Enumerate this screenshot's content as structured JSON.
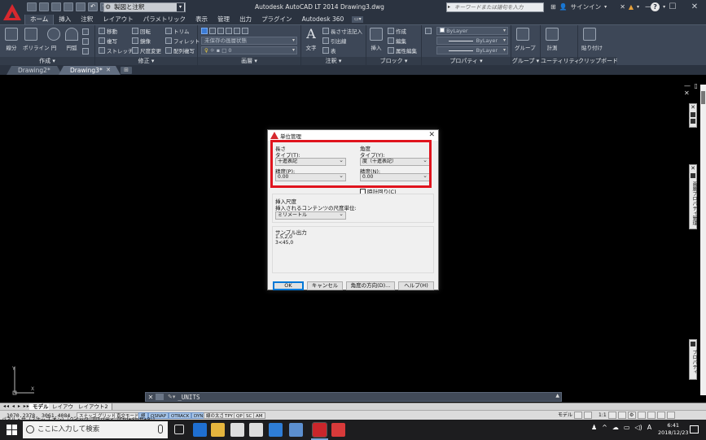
{
  "window": {
    "title": "Autodesk AutoCAD LT 2014   Drawing3.dwg",
    "workspace": "製図と注釈",
    "search_placeholder": "キーワードまたは語句を入力",
    "signin": "サインイン",
    "controls": [
      "—",
      "☐",
      "✕"
    ]
  },
  "ribbon_tabs": [
    {
      "label": "ホーム",
      "active": true
    },
    {
      "label": "挿入",
      "active": false
    },
    {
      "label": "注釈",
      "active": false
    },
    {
      "label": "レイアウト",
      "active": false
    },
    {
      "label": "パラメトリック",
      "active": false
    },
    {
      "label": "表示",
      "active": false
    },
    {
      "label": "管理",
      "active": false
    },
    {
      "label": "出力",
      "active": false
    },
    {
      "label": "プラグイン",
      "active": false
    },
    {
      "label": "Autodesk 360",
      "active": false
    }
  ],
  "ribbon": {
    "draw": {
      "title": "作成 ▾",
      "line": "線分",
      "polyline": "ポリライン",
      "circle": "円",
      "arc": "円弧"
    },
    "modify": {
      "title": "修正 ▾",
      "move": "移動",
      "rotate": "回転",
      "trim": "トリム",
      "copy": "複写",
      "mirror": "鏡像",
      "fillet": "フィレット",
      "stretch": "ストレッチ",
      "scale": "尺度変更",
      "array": "配列複写"
    },
    "layers": {
      "title": "画層 ▾",
      "state": "未保存の画層状態",
      "current": "0"
    },
    "annotation": {
      "title": "注釈 ▾",
      "text": "文字",
      "dim": "長さ寸法記入",
      "leader": "引出線",
      "table": "表"
    },
    "block": {
      "title": "ブロック ▾",
      "insert": "挿入",
      "create": "作成",
      "edit": "編集",
      "attr": "属性編集"
    },
    "properties": {
      "title": "プロパティ ▾",
      "color": "ByLayer",
      "linetype": "ByLayer",
      "lineweight": "ByLayer"
    },
    "groups": {
      "title": "グループ ▾",
      "group": "グループ"
    },
    "utilities": {
      "title": "ユーティリティ ▾",
      "measure": "計測"
    },
    "clipboard": {
      "title": "クリップボード",
      "paste": "貼り付け"
    }
  },
  "file_tabs": [
    {
      "label": "Drawing2*",
      "active": false
    },
    {
      "label": "Drawing3*",
      "active": true
    }
  ],
  "viewport": {
    "controls": "— ▯ ✕",
    "properties_label": "プロパティ",
    "layers_label": "画層プロパティ管理"
  },
  "command_line": {
    "prompt": "✎▾",
    "text": "_UNITS"
  },
  "layout_tabs": {
    "model": "モデル",
    "layout1": "レイアウト1",
    "layout2": "レイアウト2"
  },
  "status": {
    "coords": "1070.2378, 3061.4084  ,",
    "buttons": [
      "スナップ",
      "グリッド",
      "直交モード",
      "極",
      "OSNAP",
      "OTRACK",
      "DYN",
      "線の太さ",
      "TPY",
      "QP",
      "SC",
      "AM"
    ],
    "tooltip": "パネル・サ（スナップ オン）［クイック プロパティ（Ctrl+Shift+P）]",
    "model": "モデル",
    "scale": "1:1"
  },
  "dialog": {
    "title": "単位管理",
    "length": {
      "heading": "長さ",
      "type_label": "タイプ(T):",
      "type_value": "十進表記",
      "precision_label": "精度(P):",
      "precision_value": "0.00"
    },
    "angle": {
      "heading": "角度",
      "type_label": "タイプ(Y):",
      "type_value": "度（十進表記）",
      "precision_label": "精度(N):",
      "precision_value": "0.00",
      "clockwise_label": "時計回り(C)"
    },
    "insert_scale": {
      "heading": "挿入尺度",
      "label": "挿入されるコンテンツの尺度単位:",
      "value": "ミリメートル"
    },
    "sample": {
      "heading": "サンプル出力",
      "line1": "1.5,2,0",
      "line2": "3<45,0"
    },
    "buttons": {
      "ok": "OK",
      "cancel": "キャンセル",
      "direction": "角度の方向(D)...",
      "help": "ヘルプ(H)"
    }
  },
  "taskbar": {
    "search": "ここに入力して検索",
    "time": "6:41",
    "date": "2018/12/23",
    "ime": "A"
  },
  "colors": {
    "accent_red": "#e0141e",
    "title_bg": "#2b3340",
    "ribbon_bg": "#3d4757"
  }
}
